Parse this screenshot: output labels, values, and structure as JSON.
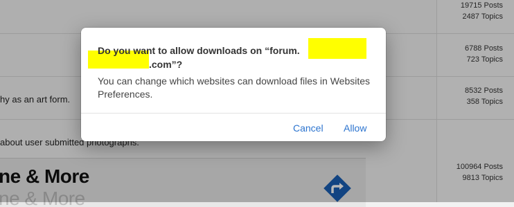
{
  "forum": {
    "stats": [
      {
        "posts": "19715 Posts",
        "topics": "2487 Topics"
      },
      {
        "posts": "6788 Posts",
        "topics": "723 Topics"
      },
      {
        "posts": "8532 Posts",
        "topics": "358 Topics"
      },
      {
        "posts": "100964 Posts",
        "topics": "9813 Topics"
      }
    ],
    "fragments": {
      "art_form": "hy as an art form.",
      "photographs": " about user submitted photographs."
    },
    "banner": {
      "title": "ne & More",
      "ghost": "ne & More"
    },
    "icons": {
      "direction": "directions-turn-icon",
      "direction_color": "#1a5fb4"
    }
  },
  "dialog": {
    "title_part1": "Do you want to allow downloads on “forum.",
    "title_part2": ".com”?",
    "message": "You can change which websites can download files in Websites Preferences.",
    "cancel_label": "Cancel",
    "allow_label": "Allow",
    "accent_color": "#2c74cf",
    "redaction_color": "#ffff00"
  }
}
